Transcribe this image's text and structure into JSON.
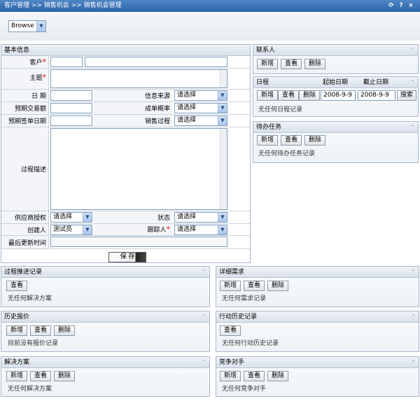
{
  "header": {
    "breadcrumb": "客户管理 >> 销售机会 >> 销售机会管理",
    "icons": [
      "refresh-icon",
      "help-icon",
      "close-icon"
    ]
  },
  "mode": {
    "selected": "Browse"
  },
  "basic": {
    "title": "基本信息",
    "customer": "客户",
    "subject": "主题",
    "date": "日  期",
    "source": "信息来源",
    "expected_amount": "预期交易额",
    "probability": "成单概率",
    "expected_sign_date": "预期签单日期",
    "sales_process": "销售过程",
    "process_desc": "过程描述",
    "supplier_auth": "供应商授权",
    "status": "状态",
    "creator": "创建人",
    "follower": "跟踪人",
    "last_update": "最后更新时间",
    "please_select": "请选择",
    "creator_value": "测试员",
    "save": "保 存",
    "required_mark": "*"
  },
  "contacts": {
    "title": "联系人",
    "add": "新增",
    "view": "查看",
    "delete": "删除"
  },
  "schedule": {
    "title": "日程",
    "start_label": "起始日期",
    "end_label": "截止日期",
    "start": "2008-9-9",
    "end": "2008-9-9",
    "search": "搜索",
    "add": "新增",
    "view": "查看",
    "delete": "删除",
    "empty": "无任何日程记录"
  },
  "tasks": {
    "title": "待办任务",
    "add": "新增",
    "view": "查看",
    "delete": "删除",
    "empty": "无任何待办任务记录"
  },
  "progress": {
    "title": "过程推进记录",
    "view": "查看",
    "empty": "无任何解决方案"
  },
  "requirements": {
    "title": "详细需求",
    "add": "新增",
    "view": "查看",
    "delete": "删除",
    "empty": "无任何需求记录"
  },
  "quotes": {
    "title": "历史报价",
    "add": "新增",
    "view": "查看",
    "delete": "删除",
    "empty": "目前没有报价记录"
  },
  "actions": {
    "title": "行动历史记录",
    "view": "查看",
    "empty": "无任何行动历史记录"
  },
  "solutions": {
    "title": "解决方案",
    "add": "新增",
    "view": "查看",
    "delete": "删除",
    "empty": "无任何解决方案"
  },
  "competitors": {
    "title": "竞争对手",
    "add": "新增",
    "view": "查看",
    "delete": "删除",
    "empty": "无任何竞争对手"
  }
}
